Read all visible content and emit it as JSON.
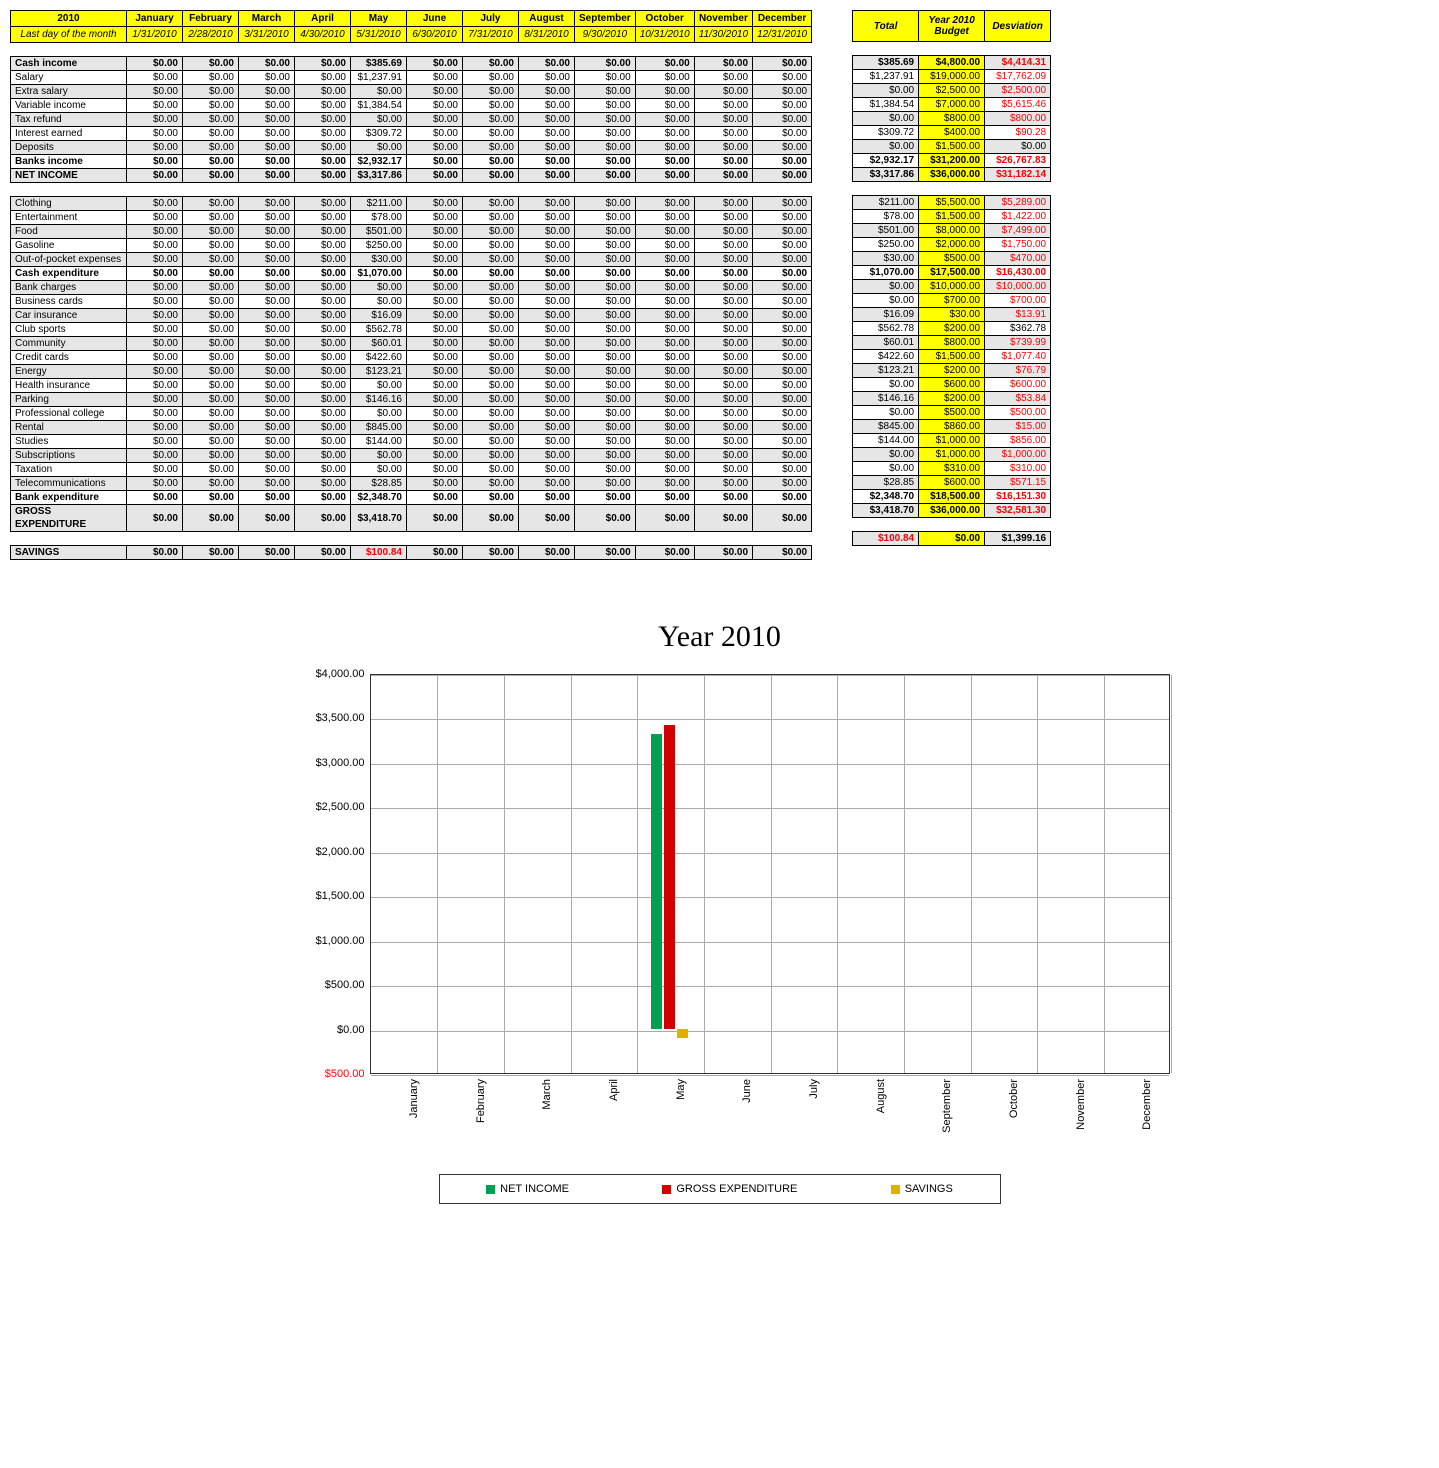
{
  "header": {
    "year_label": "2010",
    "year_sub": "Last day of the month",
    "months": [
      "January",
      "February",
      "March",
      "April",
      "May",
      "June",
      "July",
      "August",
      "September",
      "October",
      "November",
      "December"
    ],
    "dates": [
      "1/31/2010",
      "2/28/2010",
      "3/31/2010",
      "4/30/2010",
      "5/31/2010",
      "6/30/2010",
      "7/31/2010",
      "8/31/2010",
      "9/30/2010",
      "10/31/2010",
      "11/30/2010",
      "12/31/2010"
    ]
  },
  "side_header": {
    "total": "Total",
    "budget": "Year 2010\nBudget",
    "dev": "Desviation"
  },
  "sections": [
    [
      {
        "label": "Cash income",
        "bold": true,
        "shade": true,
        "may": "$385.69",
        "total": "$385.69",
        "budget": "$4,800.00",
        "dev": "$4,414.31",
        "devRed": true
      },
      {
        "label": "Salary",
        "may": "$1,237.91",
        "total": "$1,237.91",
        "budget": "$19,000.00",
        "dev": "$17,762.09",
        "devRed": true
      },
      {
        "label": "Extra salary",
        "shade": true,
        "may": "$0.00",
        "total": "$0.00",
        "budget": "$2,500.00",
        "dev": "$2,500.00",
        "devRed": true
      },
      {
        "label": "Variable income",
        "may": "$1,384.54",
        "total": "$1,384.54",
        "budget": "$7,000.00",
        "dev": "$5,615.46",
        "devRed": true
      },
      {
        "label": "Tax refund",
        "shade": true,
        "may": "$0.00",
        "total": "$0.00",
        "budget": "$800.00",
        "dev": "$800.00",
        "devRed": true
      },
      {
        "label": "Interest earned",
        "may": "$309.72",
        "total": "$309.72",
        "budget": "$400.00",
        "dev": "$90.28",
        "devRed": true
      },
      {
        "label": "Deposits",
        "shade": true,
        "may": "$0.00",
        "total": "$0.00",
        "budget": "$1,500.00",
        "dev": "$0.00"
      },
      {
        "label": "Banks income",
        "bold": true,
        "may": "$2,932.17",
        "total": "$2,932.17",
        "budget": "$31,200.00",
        "dev": "$26,767.83",
        "devRed": true
      },
      {
        "label": "NET INCOME",
        "bold": true,
        "shade": true,
        "may": "$3,317.86",
        "total": "$3,317.86",
        "budget": "$36,000.00",
        "dev": "$31,182.14",
        "devRed": true
      }
    ],
    [
      {
        "label": "Clothing",
        "shade": true,
        "may": "$211.00",
        "total": "$211.00",
        "budget": "$5,500.00",
        "dev": "$5,289.00",
        "devRed": true
      },
      {
        "label": "Entertainment",
        "may": "$78.00",
        "total": "$78.00",
        "budget": "$1,500.00",
        "dev": "$1,422.00",
        "devRed": true
      },
      {
        "label": "Food",
        "shade": true,
        "may": "$501.00",
        "total": "$501.00",
        "budget": "$8,000.00",
        "dev": "$7,499.00",
        "devRed": true
      },
      {
        "label": "Gasoline",
        "may": "$250.00",
        "total": "$250.00",
        "budget": "$2,000.00",
        "dev": "$1,750.00",
        "devRed": true
      },
      {
        "label": "Out-of-pocket expenses",
        "shade": true,
        "may": "$30.00",
        "total": "$30.00",
        "budget": "$500.00",
        "dev": "$470.00",
        "devRed": true
      },
      {
        "label": "Cash expenditure",
        "bold": true,
        "may": "$1,070.00",
        "total": "$1,070.00",
        "budget": "$17,500.00",
        "dev": "$16,430.00",
        "devRed": true
      },
      {
        "label": "Bank charges",
        "shade": true,
        "may": "$0.00",
        "total": "$0.00",
        "budget": "$10,000.00",
        "dev": "$10,000.00",
        "devRed": true
      },
      {
        "label": "Business cards",
        "may": "$0.00",
        "total": "$0.00",
        "budget": "$700.00",
        "dev": "$700.00",
        "devRed": true
      },
      {
        "label": "Car insurance",
        "shade": true,
        "may": "$16.09",
        "total": "$16.09",
        "budget": "$30.00",
        "dev": "$13.91",
        "devRed": true
      },
      {
        "label": "Club sports",
        "may": "$562.78",
        "total": "$562.78",
        "budget": "$200.00",
        "dev": "$362.78"
      },
      {
        "label": "Community",
        "shade": true,
        "may": "$60.01",
        "total": "$60.01",
        "budget": "$800.00",
        "dev": "$739.99",
        "devRed": true
      },
      {
        "label": "Credit cards",
        "may": "$422.60",
        "total": "$422.60",
        "budget": "$1,500.00",
        "dev": "$1,077.40",
        "devRed": true
      },
      {
        "label": "Energy",
        "shade": true,
        "may": "$123.21",
        "total": "$123.21",
        "budget": "$200.00",
        "dev": "$76.79",
        "devRed": true
      },
      {
        "label": "Health insurance",
        "may": "$0.00",
        "total": "$0.00",
        "budget": "$600.00",
        "dev": "$600.00",
        "devRed": true
      },
      {
        "label": "Parking",
        "shade": true,
        "may": "$146.16",
        "total": "$146.16",
        "budget": "$200.00",
        "dev": "$53.84",
        "devRed": true
      },
      {
        "label": "Professional college",
        "may": "$0.00",
        "total": "$0.00",
        "budget": "$500.00",
        "dev": "$500.00",
        "devRed": true
      },
      {
        "label": "Rental",
        "shade": true,
        "may": "$845.00",
        "total": "$845.00",
        "budget": "$860.00",
        "dev": "$15.00",
        "devRed": true
      },
      {
        "label": "Studies",
        "may": "$144.00",
        "total": "$144.00",
        "budget": "$1,000.00",
        "dev": "$856.00",
        "devRed": true
      },
      {
        "label": "Subscriptions",
        "shade": true,
        "may": "$0.00",
        "total": "$0.00",
        "budget": "$1,000.00",
        "dev": "$1,000.00",
        "devRed": true
      },
      {
        "label": "Taxation",
        "may": "$0.00",
        "total": "$0.00",
        "budget": "$310.00",
        "dev": "$310.00",
        "devRed": true
      },
      {
        "label": "Telecommunications",
        "shade": true,
        "may": "$28.85",
        "total": "$28.85",
        "budget": "$600.00",
        "dev": "$571.15",
        "devRed": true
      },
      {
        "label": "Bank expenditure",
        "bold": true,
        "may": "$2,348.70",
        "total": "$2,348.70",
        "budget": "$18,500.00",
        "dev": "$16,151.30",
        "devRed": true
      },
      {
        "label": "GROSS EXPENDITURE",
        "bold": true,
        "shade": true,
        "may": "$3,418.70",
        "total": "$3,418.70",
        "budget": "$36,000.00",
        "dev": "$32,581.30",
        "devRed": true
      }
    ],
    [
      {
        "label": "SAVINGS",
        "bold": true,
        "shade": true,
        "may": "$100.84",
        "mayRed": true,
        "total": "$100.84",
        "totalRed": true,
        "budget": "$0.00",
        "dev": "$1,399.16"
      }
    ]
  ],
  "legend": {
    "s1": "NET INCOME",
    "s2": "GROSS EXPENDITURE",
    "s3": "SAVINGS"
  },
  "chart_data": {
    "type": "bar",
    "title": "Year 2010",
    "categories": [
      "January",
      "February",
      "March",
      "April",
      "May",
      "June",
      "July",
      "August",
      "September",
      "October",
      "November",
      "December"
    ],
    "series": [
      {
        "name": "NET INCOME",
        "color": "#00a050",
        "values": [
          0,
          0,
          0,
          0,
          3317.86,
          0,
          0,
          0,
          0,
          0,
          0,
          0
        ]
      },
      {
        "name": "GROSS EXPENDITURE",
        "color": "#d00000",
        "values": [
          0,
          0,
          0,
          0,
          3418.7,
          0,
          0,
          0,
          0,
          0,
          0,
          0
        ]
      },
      {
        "name": "SAVINGS",
        "color": "#e0b000",
        "values": [
          0,
          0,
          0,
          0,
          -100.84,
          0,
          0,
          0,
          0,
          0,
          0,
          0
        ]
      }
    ],
    "ylim": [
      -500,
      4000
    ],
    "yticks": [
      -500,
      0,
      500,
      1000,
      1500,
      2000,
      2500,
      3000,
      3500,
      4000
    ],
    "ytick_labels": [
      "$500.00",
      "$0.00",
      "$500.00",
      "$1,000.00",
      "$1,500.00",
      "$2,000.00",
      "$2,500.00",
      "$3,000.00",
      "$3,500.00",
      "$4,000.00"
    ]
  }
}
